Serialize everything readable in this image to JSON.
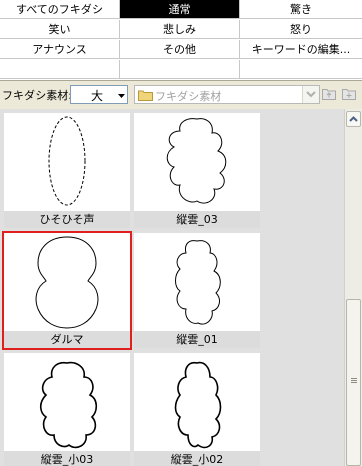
{
  "categories": [
    {
      "label": "すべてのフキダシ",
      "active": false
    },
    {
      "label": "通常",
      "active": true
    },
    {
      "label": "驚き",
      "active": false
    },
    {
      "label": "笑い",
      "active": false
    },
    {
      "label": "悲しみ",
      "active": false
    },
    {
      "label": "怒り",
      "active": false
    },
    {
      "label": "アナウンス",
      "active": false
    },
    {
      "label": "その他",
      "active": false
    },
    {
      "label": "キーワードの編集...",
      "active": false
    },
    {
      "label": "",
      "active": false
    },
    {
      "label": "",
      "active": false
    },
    {
      "label": "",
      "active": false
    }
  ],
  "toolbar": {
    "label": "フキダシ素材:",
    "size_value": "大",
    "folder_value": "フキダシ素材"
  },
  "items": [
    {
      "name": "ひそひそ声",
      "shape": "dashed-oval"
    },
    {
      "name": "縦雲_03",
      "shape": "cloud-wide"
    },
    {
      "name": "ダルマ",
      "shape": "daruma",
      "selected": true
    },
    {
      "name": "縦雲_01",
      "shape": "cloud-narrow"
    },
    {
      "name": "縦雲_小03",
      "shape": "cloud-bold-wide"
    },
    {
      "name": "縦雲_小02",
      "shape": "cloud-bold-narrow"
    }
  ],
  "colors": {
    "selection": "#e01f1f",
    "active_tab_bg": "#000000",
    "label_strip": "#dcdcdc"
  }
}
